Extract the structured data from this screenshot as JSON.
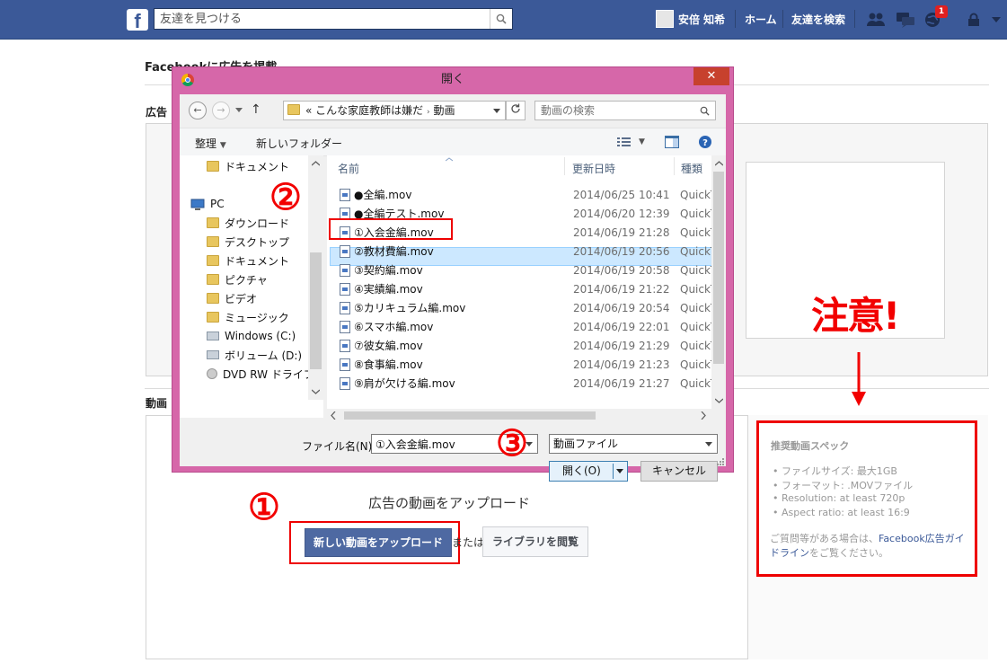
{
  "facebook": {
    "logo": "f",
    "search_placeholder": "友達を見つける",
    "user_name": "安倍 知希",
    "nav_home": "ホーム",
    "nav_find_friends": "友達を検索",
    "notification_count": "1"
  },
  "page": {
    "title": "Facebookに広告を掲載",
    "section1_label": "広告",
    "section2_label": "動画",
    "upload_heading": "広告の動画をアップロード",
    "upload_new_label": "新しい動画をアップロード",
    "or_text": "または",
    "library_label": "ライブラリを閲覧"
  },
  "specs": {
    "title": "推奨動画スペック",
    "items": [
      "ファイルサイズ: 最大1GB",
      "フォーマット: .MOVファイル",
      "Resolution: at least 720p",
      "Aspect ratio: at least 16:9"
    ],
    "note_prefix": "ご質問等がある場合は、",
    "note_link": "Facebook広告ガイドライン",
    "note_suffix": "をご覧ください。"
  },
  "annotations": {
    "caution": "注意!",
    "step1": "①",
    "step2": "②",
    "step3": "③",
    "arrow": "↓"
  },
  "dialog": {
    "title": "開く",
    "close": "✕",
    "back": "←",
    "forward": "→",
    "up": "↑",
    "breadcrumb_prefix": "«",
    "breadcrumb_parent": "こんな家庭教師は嫌だ",
    "breadcrumb_sep": "›",
    "breadcrumb_current": "動画",
    "search_placeholder": "動画の検索",
    "organize": "整理",
    "new_folder": "新しいフォルダー",
    "nav_items": [
      {
        "label": "ドキュメント",
        "icon": "folder-icon"
      },
      {
        "label": "PC",
        "icon": "pc-icon"
      },
      {
        "label": "ダウンロード",
        "icon": "folder-icon"
      },
      {
        "label": "デスクトップ",
        "icon": "folder-icon"
      },
      {
        "label": "ドキュメント",
        "icon": "folder-icon"
      },
      {
        "label": "ピクチャ",
        "icon": "folder-icon"
      },
      {
        "label": "ビデオ",
        "icon": "folder-icon"
      },
      {
        "label": "ミュージック",
        "icon": "folder-icon"
      },
      {
        "label": "Windows (C:)",
        "icon": "drive-icon"
      },
      {
        "label": "ボリューム (D:)",
        "icon": "drive-icon"
      },
      {
        "label": "DVD RW ドライブ",
        "icon": "disc-icon"
      }
    ],
    "columns": {
      "name": "名前",
      "date": "更新日時",
      "type": "種類"
    },
    "files": [
      {
        "name": "●全編.mov",
        "date": "2014/06/25 10:41",
        "type": "QuickT"
      },
      {
        "name": "●全編テスト.mov",
        "date": "2014/06/20 12:39",
        "type": "QuickT"
      },
      {
        "name": "①入会金編.mov",
        "date": "2014/06/19 21:28",
        "type": "QuickT"
      },
      {
        "name": "②教材費編.mov",
        "date": "2014/06/19 20:56",
        "type": "QuickT"
      },
      {
        "name": "③契約編.mov",
        "date": "2014/06/19 20:58",
        "type": "QuickT"
      },
      {
        "name": "④実績編.mov",
        "date": "2014/06/19 21:22",
        "type": "QuickT"
      },
      {
        "name": "⑤カリキュラム編.mov",
        "date": "2014/06/19 20:54",
        "type": "QuickT"
      },
      {
        "name": "⑥スマホ編.mov",
        "date": "2014/06/19 22:01",
        "type": "QuickT"
      },
      {
        "name": "⑦彼女編.mov",
        "date": "2014/06/19 21:29",
        "type": "QuickT"
      },
      {
        "name": "⑧食事編.mov",
        "date": "2014/06/19 21:23",
        "type": "QuickT"
      },
      {
        "name": "⑨肩が欠ける編.mov",
        "date": "2014/06/19 21:27",
        "type": "QuickT"
      }
    ],
    "filename_label": "ファイル名(N):",
    "filename_value": "①入会金編.mov",
    "filetype_value": "動画ファイル",
    "open_label": "開く(O)",
    "cancel_label": "キャンセル"
  }
}
